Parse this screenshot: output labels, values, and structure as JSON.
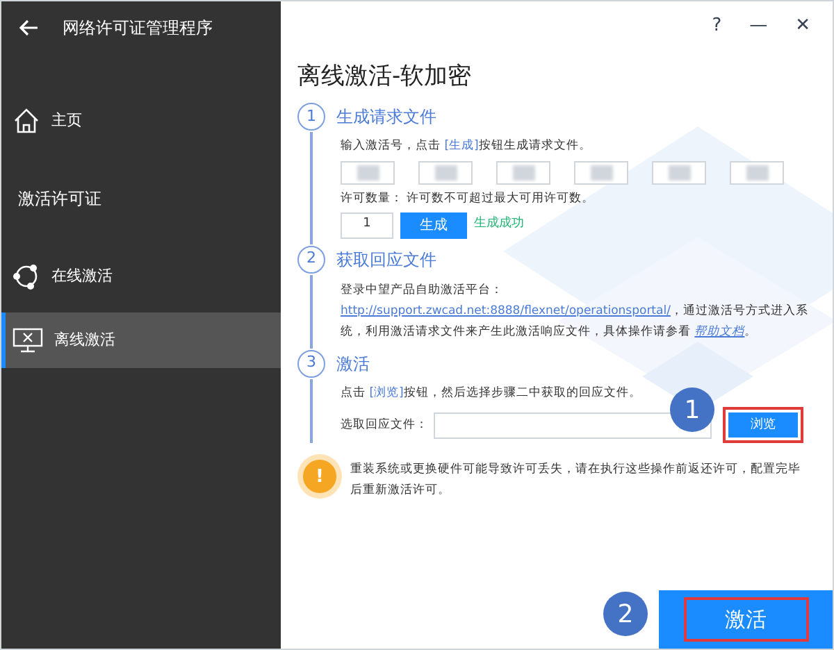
{
  "sidebar": {
    "title": "网络许可证管理程序",
    "items": [
      {
        "kind": "nav",
        "label": "主页",
        "selected": false
      },
      {
        "kind": "heading",
        "label": "激活许可证"
      },
      {
        "kind": "nav",
        "label": "在线激活",
        "selected": false
      },
      {
        "kind": "nav",
        "label": "离线激活",
        "selected": true
      }
    ]
  },
  "window_controls": [
    "?",
    "—",
    "✕"
  ],
  "page_title": "离线激活-软加密",
  "steps": [
    {
      "number": "1",
      "title": "生成请求文件"
    },
    {
      "number": "2",
      "title": "获取回应文件"
    },
    {
      "number": "3",
      "title": "激活"
    }
  ],
  "step1": {
    "instruction_before": "输入激活号，点击 ",
    "instruction_link": "[生成]",
    "instruction_after": "按钮生成请求文件。",
    "code_fields": [
      {
        "blurred": true
      },
      {
        "blurred": true
      },
      {
        "blurred": true
      },
      {
        "blurred": true
      },
      {
        "blurred": true
      },
      {
        "blurred": true
      }
    ],
    "count_label": "许可数量：  许可数不可超过最大可用许可数。",
    "count_value": "1",
    "generate_button": "生成",
    "status": "生成成功"
  },
  "step2": {
    "text_before": "登录中望产品自助激活平台：",
    "url": "http://support.zwcad.net:8888/flexnet/operationsportal/",
    "text_after": "，通过激活号方式进入系统，利用激活请求文件来产生此激活响应文件，具体操作请参看 ",
    "help_link": "帮助文档",
    "text_end": "。"
  },
  "step3": {
    "instruction_before": "点击 ",
    "instruction_link": "[浏览]",
    "instruction_after": "按钮，然后选择步骤二中获取的回应文件。",
    "file_label": "选取回应文件：",
    "browse_button": "浏览"
  },
  "warning_icon": "!",
  "warning": "重装系统或更换硬件可能导致许可丢失，请在执行这些操作前返还许可，配置完毕后重新激活许可。",
  "activate_button": "激活",
  "callouts": [
    {
      "number": "1"
    },
    {
      "number": "2"
    }
  ]
}
